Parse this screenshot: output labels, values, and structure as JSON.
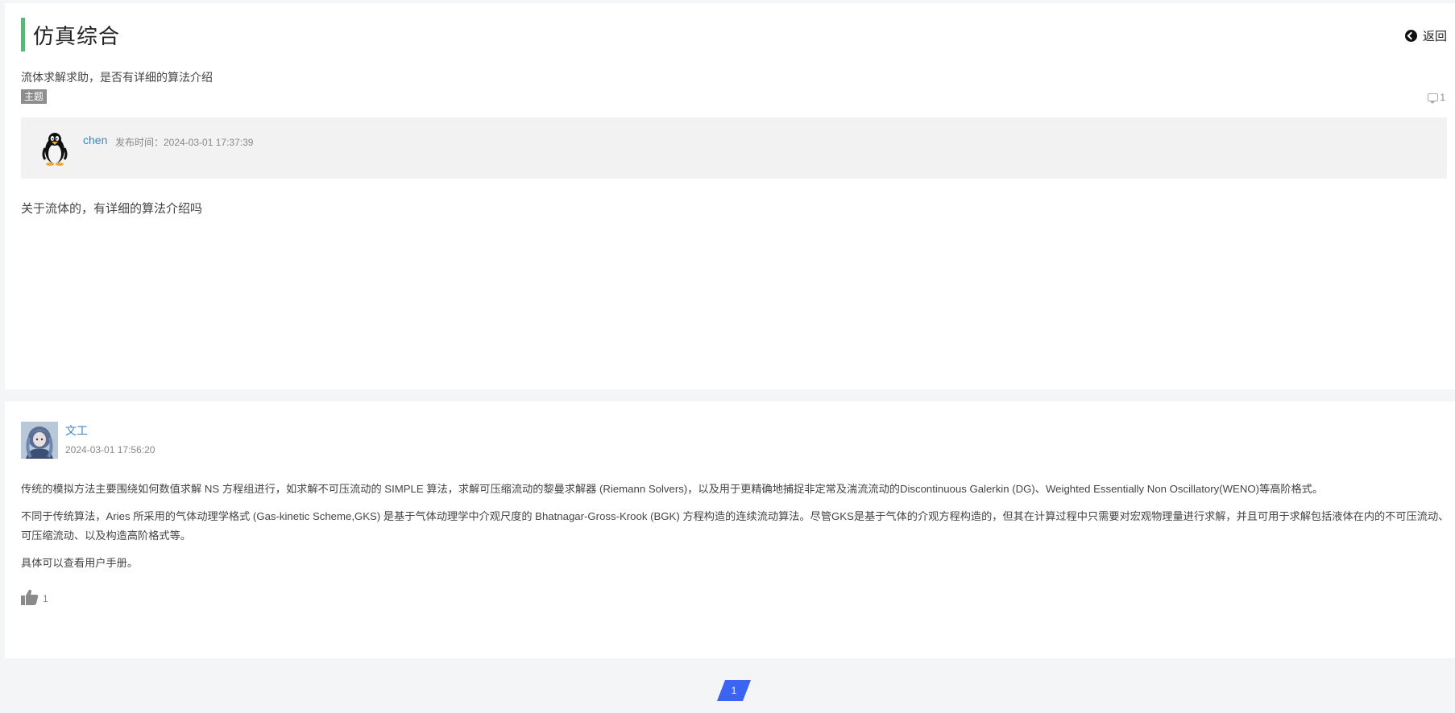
{
  "header": {
    "title": "仿真综合",
    "back_label": "返回",
    "accent_color": "#5cb67a"
  },
  "topic": {
    "subject": "流体求解求助，是否有详细的算法介绍",
    "badge": "主题",
    "reply_count": "1",
    "author": {
      "name": "chen",
      "time_label": "发布时间：2024-03-01 17:37:39",
      "avatar_icon": "penguin-avatar"
    },
    "body": "关于流体的，有详细的算法介绍吗"
  },
  "reply": {
    "author": "文工",
    "time": "2024-03-01 17:56:20",
    "paragraphs": [
      "传统的模拟方法主要围绕如何数值求解 NS 方程组进行，如求解不可压流动的 SIMPLE 算法，求解可压缩流动的黎曼求解器 (Riemann Solvers)，以及用于更精确地捕捉非定常及湍流流动的Discontinuous Galerkin (DG)、Weighted Essentially Non Oscillatory(WENO)等高阶格式。",
      "不同于传统算法，Aries 所采用的气体动理学格式 (Gas-kinetic Scheme,GKS) 是基于气体动理学中介观尺度的 Bhatnagar-Gross-Krook (BGK) 方程构造的连续流动算法。尽管GKS是基于气体的介观方程构造的，但其在计算过程中只需要对宏观物理量进行求解，并且可用于求解包括液体在内的不可压流动、可压缩流动、以及构造高阶格式等。",
      "具体可以查看用户手册。"
    ],
    "like_count": "1",
    "link_color": "#3a87c8"
  },
  "pagination": {
    "current": "1",
    "active_color": "#3b64f3"
  }
}
